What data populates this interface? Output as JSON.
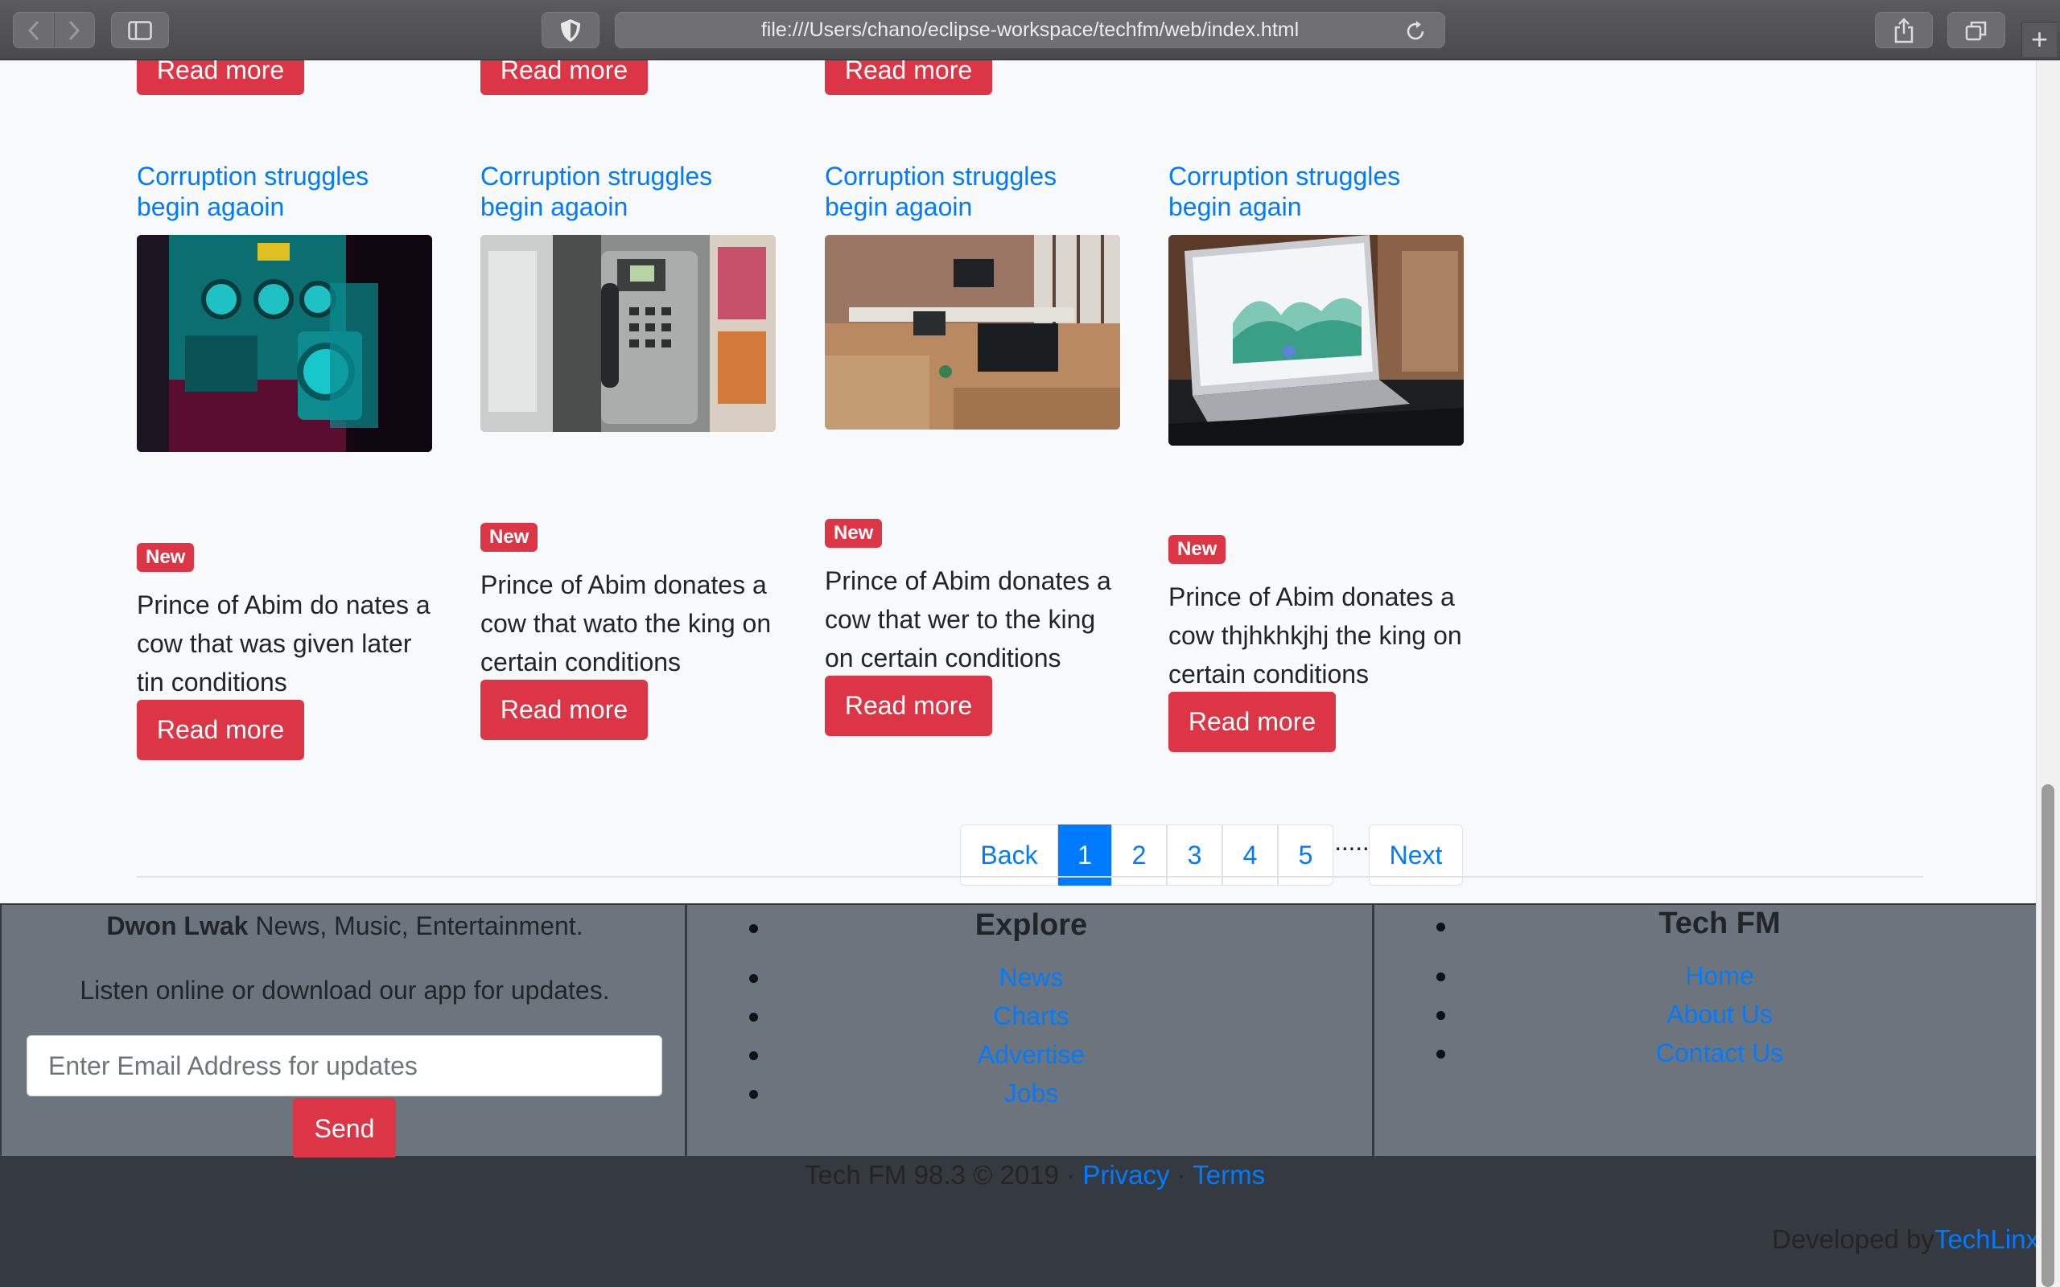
{
  "browser": {
    "url": "file:///Users/chano/eclipse-workspace/techfm/web/index.html",
    "new_tab": "+"
  },
  "top_row": {
    "read_more": "Read more"
  },
  "cards": [
    {
      "title": "Corruption struggles begin agaoin",
      "badge": "New",
      "text": "Prince of Abim do nates a cow that was given later tin conditions",
      "button": "Read more",
      "image": "laundromat"
    },
    {
      "title": "Corruption struggles begin agaoin",
      "badge": "New",
      "text": "Prince of Abim donates a cow that wato the king on certain conditions",
      "button": "Read more",
      "image": "payphone"
    },
    {
      "title": "Corruption struggles begin agaoin",
      "badge": "New",
      "text": "Prince of Abim donates a cow that wer to the king on certain conditions",
      "button": "Read more",
      "image": "office"
    },
    {
      "title": "Corruption struggles begin again",
      "badge": "New",
      "text": "Prince of Abim donates a cow thjhkhkjhj the king on certain conditions",
      "button": "Read more",
      "image": "laptop-dashboard"
    }
  ],
  "pagination": {
    "back": "Back",
    "pages": [
      "1",
      "2",
      "3",
      "4",
      "5"
    ],
    "active_page": "1",
    "ellipsis": "·····",
    "next": "Next"
  },
  "footer": {
    "brand": "Dwon Lwak",
    "tagline": "News, Music, Entertainment.",
    "listen": "Listen online or download our app for updates.",
    "email_placeholder": "Enter Email Address for updates",
    "send": "Send",
    "explore": {
      "heading": "Explore",
      "links": [
        "News",
        "Charts",
        "Advertise",
        "Jobs"
      ]
    },
    "techfm": {
      "heading": "Tech FM",
      "links": [
        "Home",
        "About Us",
        "Contact Us"
      ]
    },
    "copyright": "Tech FM 98.3 © 2019 ·",
    "privacy": "Privacy",
    "separator": "·",
    "terms": "Terms",
    "developed_by": "Developed by",
    "developer": "TechLinx"
  },
  "colors": {
    "accent": "#007bff",
    "danger": "#dc3545",
    "footer_bg": "#6c757d",
    "footer_dark": "#343a40"
  }
}
